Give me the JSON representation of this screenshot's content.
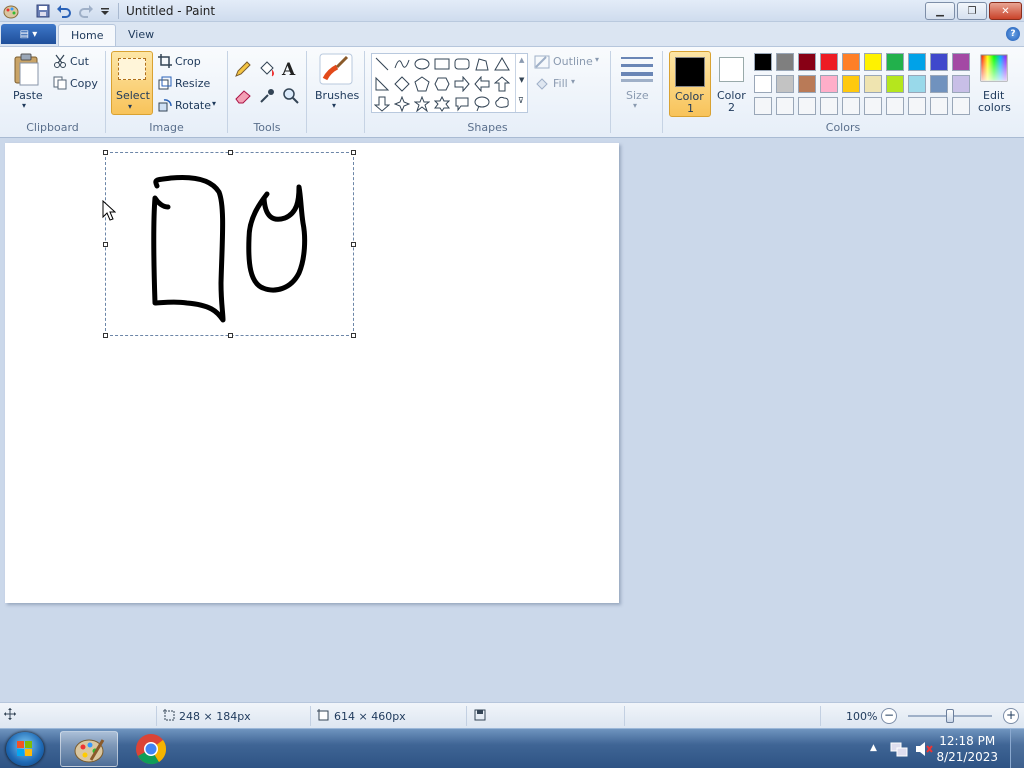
{
  "window": {
    "title": "Untitled - Paint",
    "minimize_icon": "minimize-icon",
    "maximize_icon": "restore-icon",
    "close_icon": "close-icon"
  },
  "quick_access": [
    "paint-app-icon",
    "save-icon",
    "undo-icon",
    "redo-icon",
    "customize-dropdown-icon"
  ],
  "tabs": [
    {
      "label": "Home",
      "active": true
    },
    {
      "label": "View",
      "active": false
    }
  ],
  "ribbon": {
    "clipboard": {
      "label": "Clipboard",
      "paste": "Paste",
      "cut": "Cut",
      "copy": "Copy"
    },
    "image": {
      "label": "Image",
      "select": "Select",
      "crop": "Crop",
      "resize": "Resize",
      "rotate": "Rotate"
    },
    "tools": {
      "label": "Tools"
    },
    "brushes": {
      "label": "Brushes"
    },
    "shapes": {
      "label": "Shapes",
      "outline": "Outline",
      "fill": "Fill"
    },
    "size": {
      "label": "Size"
    },
    "colors": {
      "label": "Colors",
      "color1_line1": "Color",
      "color1_line2": "1",
      "color2_line1": "Color",
      "color2_line2": "2",
      "edit_line1": "Edit",
      "edit_line2": "colors",
      "color1_value": "#000000",
      "color2_value": "#ffffff",
      "palette_row1": [
        "#000000",
        "#7f7f7f",
        "#880015",
        "#ed1c24",
        "#ff7f27",
        "#fff200",
        "#22b14c",
        "#00a2e8",
        "#3f48cc",
        "#a349a4"
      ],
      "palette_row2": [
        "#ffffff",
        "#c3c3c3",
        "#b97a57",
        "#ffaec9",
        "#ffc90e",
        "#efe4b0",
        "#b5e61d",
        "#99d9ea",
        "#7092be",
        "#c8bfe7"
      ],
      "palette_row3": [
        "#f4f6f9",
        "#f4f6f9",
        "#f4f6f9",
        "#f4f6f9",
        "#f4f6f9",
        "#f4f6f9",
        "#f4f6f9",
        "#f4f6f9",
        "#f4f6f9",
        "#f4f6f9"
      ]
    }
  },
  "status": {
    "selection_size": "248 × 184px",
    "canvas_size": "614 × 460px",
    "zoom": "100%",
    "zoom_level": 1.0
  },
  "taskbar": {
    "time": "12:18 PM",
    "date": "8/21/2023"
  }
}
